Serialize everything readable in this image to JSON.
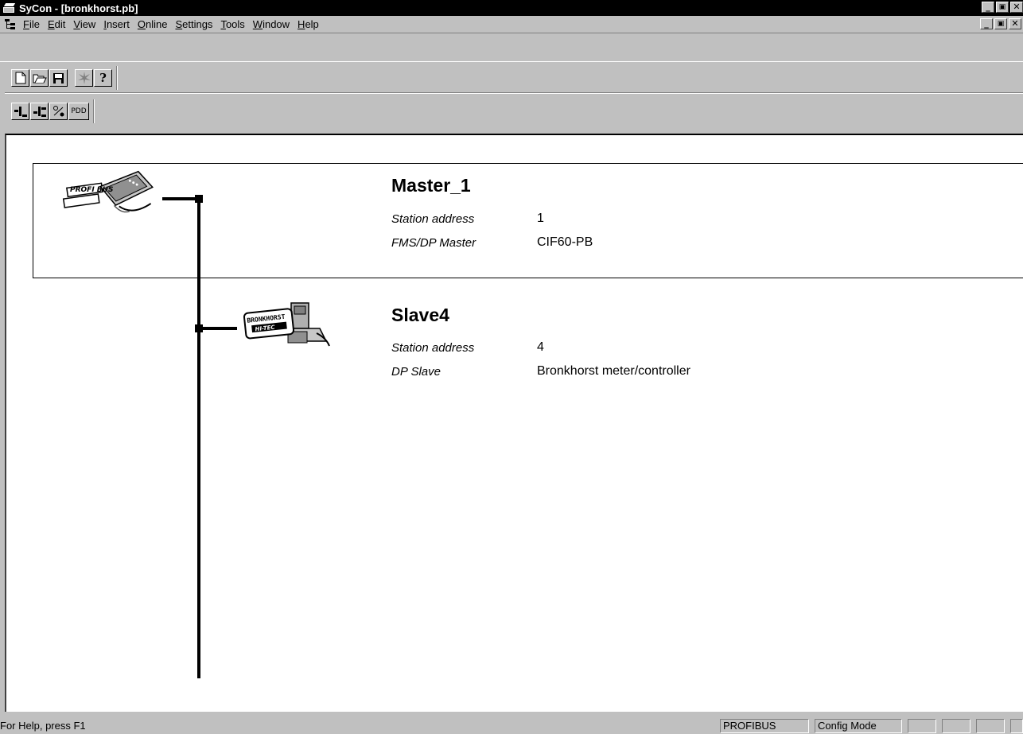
{
  "window": {
    "title": "SyCon - [bronkhorst.pb]",
    "min_glyph": "_",
    "restore_glyph": "🗗",
    "close_glyph": "✕"
  },
  "menu": {
    "items": [
      {
        "label": "File"
      },
      {
        "label": "Edit"
      },
      {
        "label": "View"
      },
      {
        "label": "Insert"
      },
      {
        "label": "Online"
      },
      {
        "label": "Settings"
      },
      {
        "label": "Tools"
      },
      {
        "label": "Window"
      },
      {
        "label": "Help"
      }
    ]
  },
  "toolbar2": {
    "pdd_label": "PDD"
  },
  "master": {
    "name": "Master_1",
    "addr_label": "Station address",
    "addr_value": "1",
    "type_label": "FMS/DP Master",
    "type_value": "CIF60-PB",
    "icon_text": "PROFI BUS"
  },
  "slave": {
    "name": "Slave4",
    "addr_label": "Station address",
    "addr_value": "4",
    "type_label": "DP Slave",
    "type_value": "Bronkhorst meter/controller",
    "icon_text_top": "BRONKHORST",
    "icon_text_bottom": "HI-TEC"
  },
  "status": {
    "help": "For Help, press F1",
    "protocol": "PROFIBUS",
    "mode": "Config Mode"
  }
}
